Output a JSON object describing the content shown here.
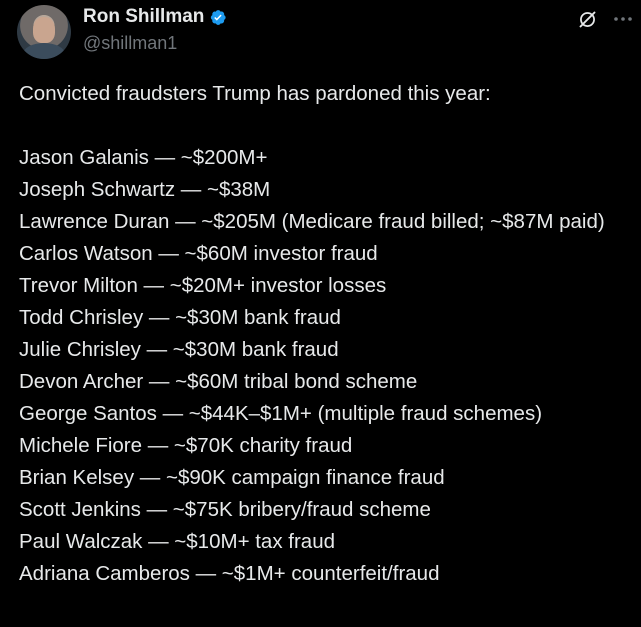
{
  "author": {
    "display_name": "Ron Shillman",
    "handle": "@shillman1",
    "verified_color": "#1d9bf0"
  },
  "icons": {
    "verified": "verified-badge-icon",
    "grok": "grok-icon",
    "more": "more-options-icon"
  },
  "tweet": {
    "intro": "Convicted fraudsters Trump has pardoned this year:",
    "lines": [
      "Jason Galanis — ~$200M+",
      "Joseph Schwartz — ~$38M",
      "Lawrence Duran — ~$205M (Medicare fraud billed; ~$87M paid)",
      "Carlos Watson — ~$60M investor fraud",
      "Trevor Milton — ~$20M+ investor losses",
      "Todd Chrisley — ~$30M bank fraud",
      "Julie Chrisley — ~$30M bank fraud",
      "Devon Archer — ~$60M tribal bond scheme",
      "George Santos — ~$44K–$1M+ (multiple fraud schemes)",
      "Michele Fiore — ~$70K charity fraud",
      "Brian Kelsey — ~$90K campaign finance fraud",
      "Scott Jenkins — ~$75K bribery/fraud scheme",
      "Paul Walczak — ~$10M+ tax fraud",
      "Adriana Camberos — ~$1M+ counterfeit/fraud"
    ]
  }
}
